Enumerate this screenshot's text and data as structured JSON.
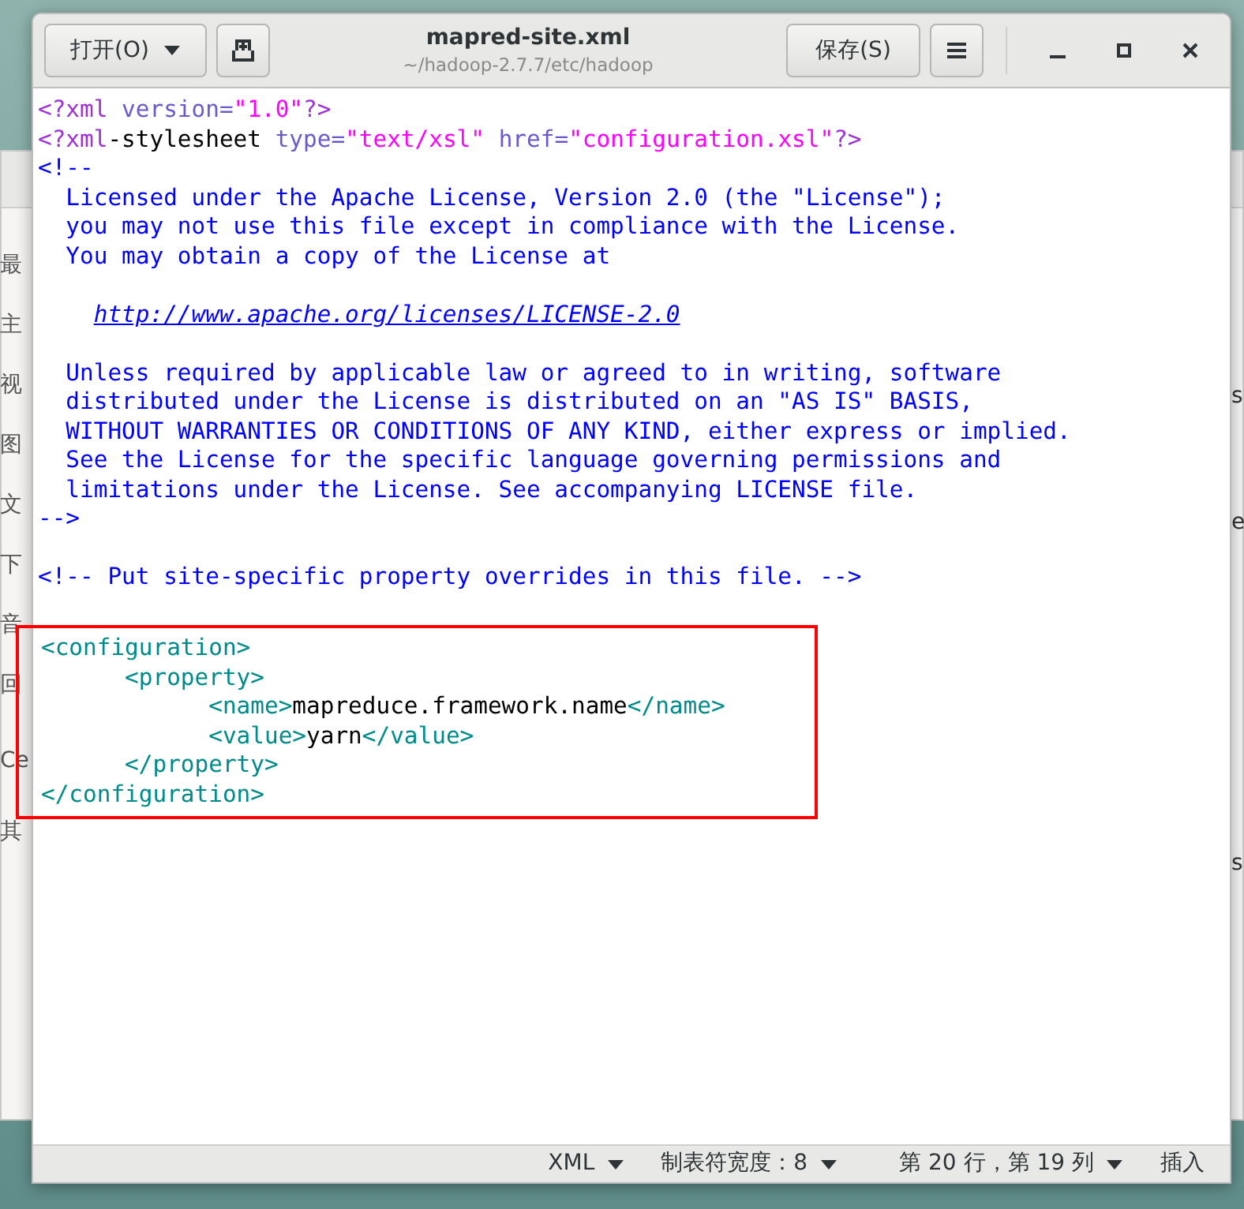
{
  "background_window": {
    "sidebar_items": [
      "最",
      "主",
      "视",
      "图",
      "文",
      "下",
      "音",
      "回",
      "Ce",
      "其"
    ],
    "right_fragments": [
      "s",
      "e",
      "s"
    ]
  },
  "window": {
    "title": "mapred-site.xml",
    "subtitle": "~/hadoop-2.7.7/etc/hadoop",
    "open_button": "打开(O)",
    "save_button": "保存(S)"
  },
  "code_blocks": [
    {
      "highlighted": false,
      "lines": [
        {
          "segments": [
            {
              "kind": "pi",
              "text": "<?xml"
            },
            {
              "kind": "attr",
              "text": " version="
            },
            {
              "kind": "string",
              "text": "\"1.0\""
            },
            {
              "kind": "pi",
              "text": "?>"
            }
          ]
        },
        {
          "segments": [
            {
              "kind": "pi",
              "text": "<?xml"
            },
            {
              "kind": "text",
              "text": "-stylesheet"
            },
            {
              "kind": "attr",
              "text": " type="
            },
            {
              "kind": "string",
              "text": "\"text/xsl\""
            },
            {
              "kind": "attr",
              "text": " href="
            },
            {
              "kind": "string",
              "text": "\"configuration.xsl\""
            },
            {
              "kind": "pi",
              "text": "?>"
            }
          ]
        },
        {
          "segments": [
            {
              "kind": "comment",
              "text": "<!--"
            }
          ]
        },
        {
          "segments": [
            {
              "kind": "comment",
              "text": "  Licensed under the Apache License, Version 2.0 (the \"License\");"
            }
          ]
        },
        {
          "segments": [
            {
              "kind": "comment",
              "text": "  you may not use this file except in compliance with the License."
            }
          ]
        },
        {
          "segments": [
            {
              "kind": "comment",
              "text": "  You may obtain a copy of the License at"
            }
          ]
        },
        {
          "kind": "blank"
        },
        {
          "segments": [
            {
              "kind": "link",
              "text": "http://www.apache.org/licenses/LICENSE-2.0"
            }
          ]
        },
        {
          "kind": "blank"
        },
        {
          "segments": [
            {
              "kind": "comment",
              "text": "  Unless required by applicable law or agreed to in writing, software"
            }
          ]
        },
        {
          "segments": [
            {
              "kind": "comment",
              "text": "  distributed under the License is distributed on an \"AS IS\" BASIS,"
            }
          ]
        },
        {
          "segments": [
            {
              "kind": "comment",
              "text": "  WITHOUT WARRANTIES OR CONDITIONS OF ANY KIND, either express or implied."
            }
          ]
        },
        {
          "segments": [
            {
              "kind": "comment",
              "text": "  See the License for the specific language governing permissions and"
            }
          ]
        },
        {
          "segments": [
            {
              "kind": "comment",
              "text": "  limitations under the License. See accompanying LICENSE file."
            }
          ]
        },
        {
          "segments": [
            {
              "kind": "comment",
              "text": "-->"
            }
          ]
        },
        {
          "kind": "blank"
        },
        {
          "segments": [
            {
              "kind": "comment",
              "text": "<!-- Put site-specific property overrides in this file. -->"
            }
          ]
        },
        {
          "kind": "blank"
        }
      ]
    },
    {
      "highlighted": true,
      "lines": [
        {
          "segments": [
            {
              "kind": "tag",
              "text": "<configuration>"
            }
          ]
        },
        {
          "segments": [
            {
              "kind": "tag",
              "text": "      <property>"
            }
          ]
        },
        {
          "segments": [
            {
              "kind": "tag",
              "text": "            <name>"
            },
            {
              "kind": "text",
              "text": "mapreduce.framework.name"
            },
            {
              "kind": "tag",
              "text": "</name>"
            }
          ]
        },
        {
          "segments": [
            {
              "kind": "tag",
              "text": "            <value>"
            },
            {
              "kind": "text",
              "text": "yarn"
            },
            {
              "kind": "tag",
              "text": "</value>"
            }
          ]
        },
        {
          "segments": [
            {
              "kind": "tag",
              "text": "      </property>"
            }
          ]
        },
        {
          "segments": [
            {
              "kind": "tag",
              "text": "</configuration>"
            }
          ]
        }
      ]
    }
  ],
  "status_bar": {
    "language": "XML",
    "tab_width": "制表符宽度：8",
    "position": "第 20 行，第 19 列",
    "mode": "插入"
  }
}
